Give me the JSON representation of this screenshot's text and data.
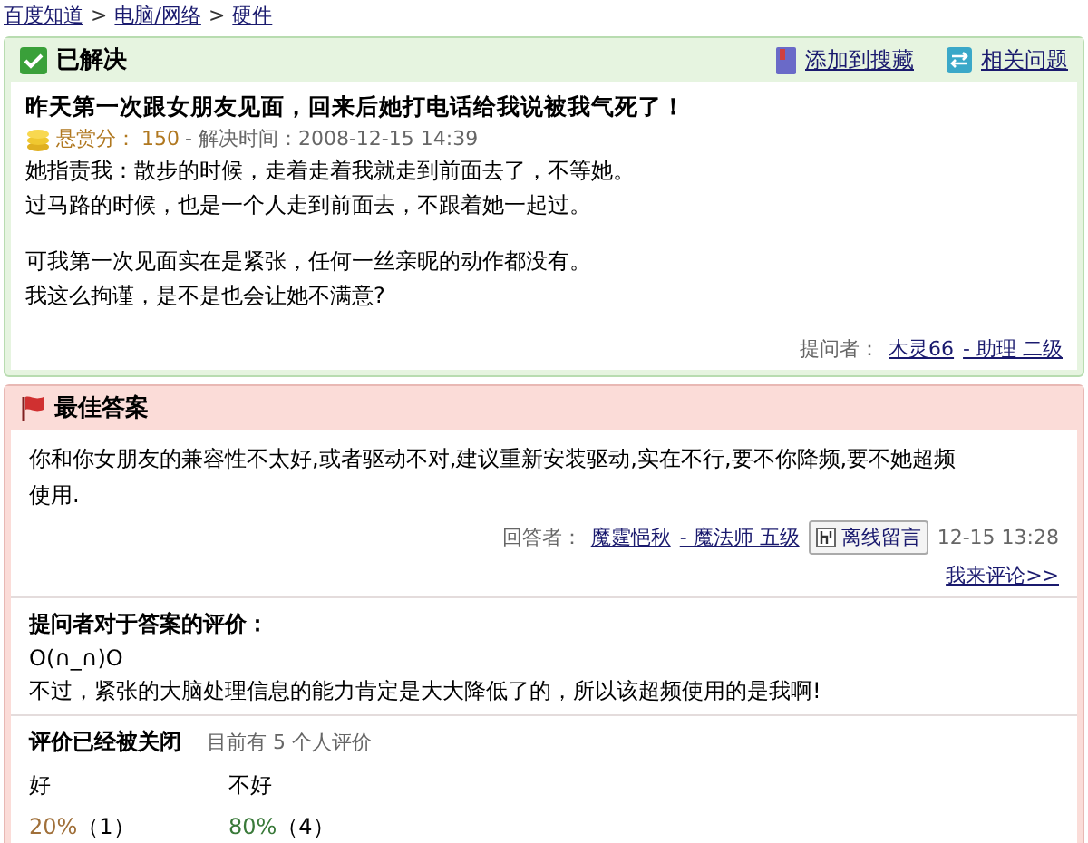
{
  "breadcrumb": [
    "百度知道",
    "电脑/网络",
    "硬件"
  ],
  "breadcrumb_separator": ">",
  "question": {
    "status": "已解决",
    "actions": [
      "添加到搜藏",
      "相关问题"
    ],
    "title": "昨天第一次跟女朋友见面，回来后她打电话给我说被我气死了！",
    "reward_label": "悬赏分：",
    "reward": "150",
    "solved_label": "- 解决时间：2008-12-15 14:39",
    "paragraphs": [
      [
        "她指责我：散步的时候，走着走着我就走到前面去了，不等她。",
        "过马路的时候，也是一个人走到前面去，不跟着她一起过。"
      ],
      [
        "可我第一次见面实在是紧张，任何一丝亲昵的动作都没有。",
        "我这么拘谨，是不是也会让她不满意?"
      ]
    ],
    "asker_label": "提问者：",
    "asker": "木灵66",
    "asker_rank": "- 助理 二级"
  },
  "answer": {
    "title": "最佳答案",
    "text": "你和你女朋友的兼容性不太好,或者驱动不对,建议重新安装驱动,实在不行,要不你降频,要不她超频使用.",
    "answerer_label": "回答者：",
    "answerer": "魔霆悒秋",
    "answerer_rank": "- 魔法师 五级",
    "message_button": "离线留言",
    "time": "12-15 13:28",
    "comment_link": "我来评论>>",
    "evaluation_title": "提问者对于答案的评价：",
    "evaluation_lines": [
      "O(∩_∩)O",
      "不过，紧张的大脑处理信息的能力肯定是大大降低了的，所以该超频使用的是我啊!"
    ],
    "rating_title": "评价已经被关闭",
    "rating_count": "目前有 5 个人评价",
    "ratings": [
      {
        "label": "好",
        "percent": "20%",
        "count": "（1）",
        "color": "#a0703a"
      },
      {
        "label": "不好",
        "percent": "80%",
        "count": "（4）",
        "color": "#3a7a3a"
      }
    ]
  }
}
